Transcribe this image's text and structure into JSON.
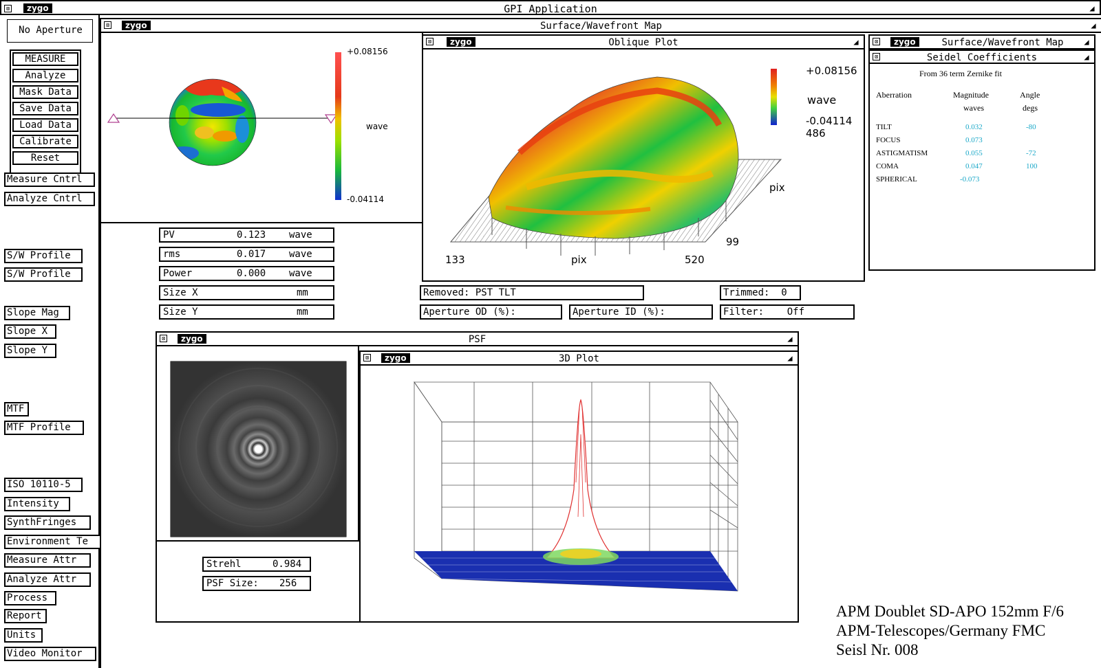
{
  "app": {
    "title": "GPI Application",
    "logo": "zygo"
  },
  "aperture_label": "No Aperture",
  "measure_group": [
    "MEASURE",
    "Analyze",
    "Mask Data",
    "Save Data",
    "Load Data",
    "Calibrate",
    "Reset"
  ],
  "side_buttons": {
    "measure_cntrl": "Measure Cntrl",
    "analyze_cntrl": "Analyze Cntrl",
    "sw_profile_1": "S/W Profile",
    "sw_profile_2": "S/W Profile",
    "slope_mag": "Slope Mag",
    "slope_x": "Slope X",
    "slope_y": "Slope Y",
    "mtf": "MTF",
    "mtf_profile": "MTF Profile",
    "iso": "ISO 10110-5",
    "intensity": "Intensity",
    "synthfringes": "SynthFringes",
    "environment": "Environment Te",
    "measure_attr": "Measure Attr",
    "analyze_attr": "Analyze Attr",
    "process": "Process",
    "report": "Report",
    "units": "Units",
    "video_monitor": "Video Monitor"
  },
  "surface_window": {
    "title": "Surface/Wavefront Map",
    "scale_max": "+0.08156",
    "scale_min": "-0.04114",
    "scale_unit": "wave"
  },
  "stats": {
    "pv": {
      "label": "PV",
      "value": "0.123",
      "unit": "wave"
    },
    "rms": {
      "label": "rms",
      "value": "0.017",
      "unit": "wave"
    },
    "power": {
      "label": "Power",
      "value": "0.000",
      "unit": "wave"
    },
    "size_x": {
      "label": "Size X",
      "value": "",
      "unit": "mm"
    },
    "size_y": {
      "label": "Size Y",
      "value": "",
      "unit": "mm"
    }
  },
  "oblique_plot": {
    "title": "Oblique Plot",
    "scale_max": "+0.08156",
    "scale_unit": "wave",
    "scale_min": "-0.04114",
    "extra": "486",
    "x_min": "133",
    "x_label": "pix",
    "x_max": "520",
    "y_label": "pix",
    "y_min": "99"
  },
  "info_fields": {
    "removed": "Removed: PST TLT",
    "trimmed": "Trimmed:  0",
    "aperture_od": "Aperture OD (%):",
    "aperture_id": "Aperture ID (%):",
    "filter": "Filter:    Off"
  },
  "seidel": {
    "back_title": "Surface/Wavefront Map",
    "title": "Seidel Coefficients",
    "subtitle": "From 36 term Zernike fit",
    "col_aberration": "Aberration",
    "col_magnitude": "Magnitude",
    "col_magnitude_unit": "waves",
    "col_angle": "Angle",
    "col_angle_unit": "degs",
    "rows": [
      {
        "name": "TILT",
        "mag": "0.032",
        "angle": "-80"
      },
      {
        "name": "FOCUS",
        "mag": "0.073",
        "angle": ""
      },
      {
        "name": "ASTIGMATISM",
        "mag": "0.055",
        "angle": "-72"
      },
      {
        "name": "COMA",
        "mag": "0.047",
        "angle": "100"
      },
      {
        "name": "SPHERICAL",
        "mag": "-0.073",
        "angle": ""
      }
    ]
  },
  "psf": {
    "title": "PSF",
    "strehl_label": "Strehl",
    "strehl_value": "0.984",
    "size_label": "PSF Size:",
    "size_value": "256"
  },
  "plot3d": {
    "title": "3D Plot"
  },
  "footer": {
    "line1": "APM Doublet SD-APO 152mm F/6",
    "line2": "APM-Telescopes/Germany FMC",
    "line3": "Seisl Nr. 008"
  },
  "colors": {
    "value_cyan": "#1aa8c8",
    "frame": "#000000"
  }
}
